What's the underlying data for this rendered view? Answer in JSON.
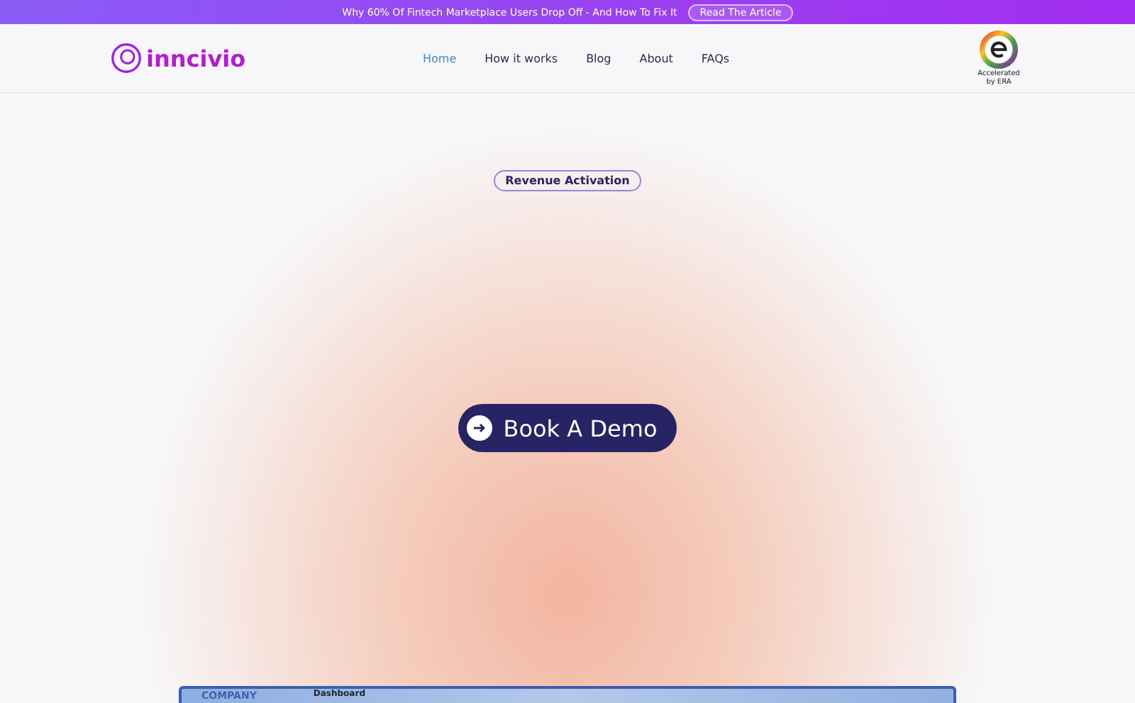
{
  "banner": {
    "text": "Why 60% Of Fintech Marketplace Users Drop Off - And How To Fix It",
    "link": "Read The Article"
  },
  "header": {
    "logo": "inncivio",
    "nav": [
      {
        "label": "Home",
        "selected": true
      },
      {
        "label": "How it works",
        "selected": false
      },
      {
        "label": "Blog",
        "selected": false
      },
      {
        "label": "About",
        "selected": false
      },
      {
        "label": "FAQs",
        "selected": false
      }
    ],
    "badge": {
      "caption": "Accelerated by ERA"
    }
  },
  "hero": {
    "tag": "Revenue Activation",
    "cta": "Book A Demo"
  },
  "preview": {
    "brand": "COMPANY",
    "title": "Dashboard"
  }
}
